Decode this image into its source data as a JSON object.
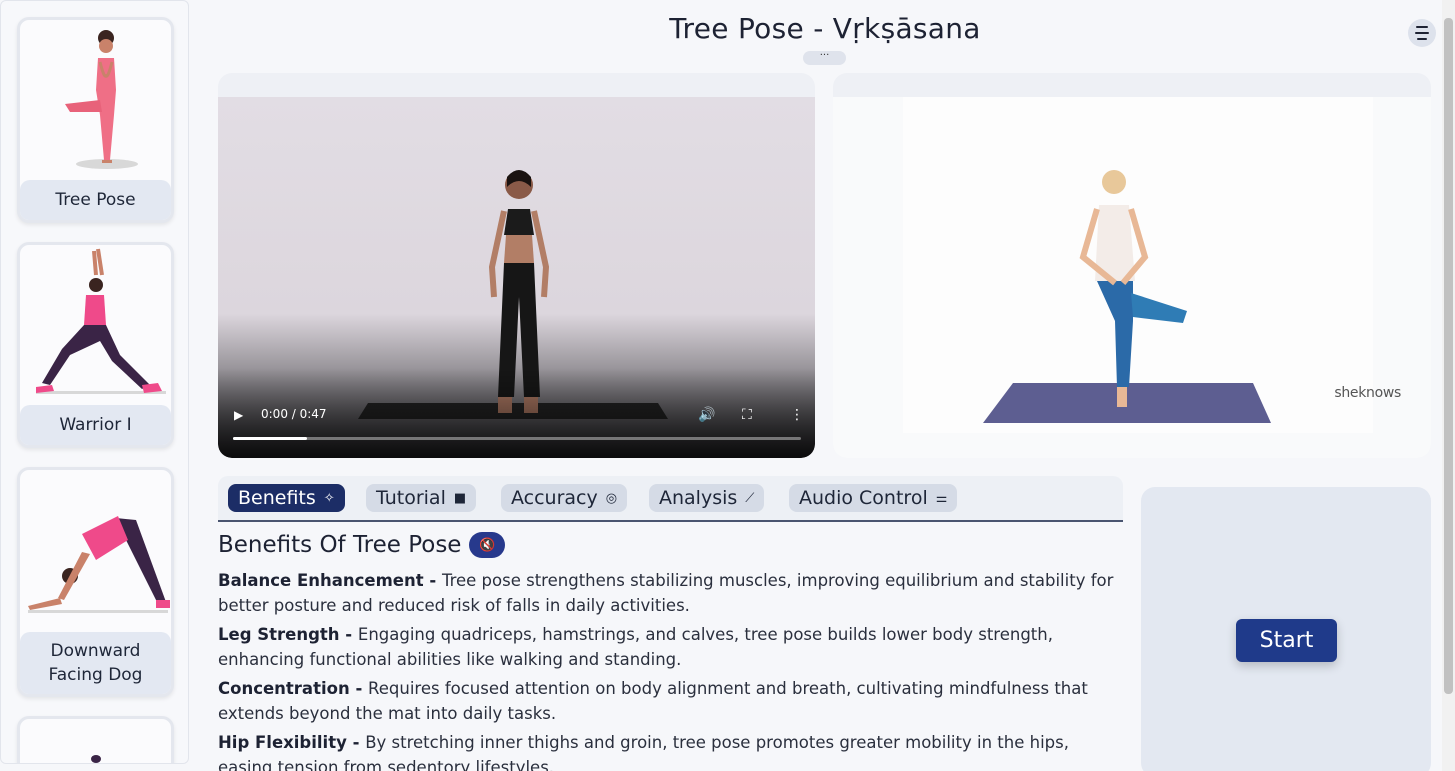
{
  "sidebar": {
    "poses": [
      {
        "label": "Tree Pose"
      },
      {
        "label": "Warrior I"
      },
      {
        "label": "Downward Facing Dog"
      },
      {
        "label": ""
      }
    ]
  },
  "header": {
    "title": "Tree Pose - Vṛkṣāsana",
    "more": "···"
  },
  "video": {
    "time": "0:00 / 0:47",
    "progress_fraction": 0.13
  },
  "reference": {
    "watermark": "sheknows"
  },
  "tabs": [
    {
      "label": "Benefits",
      "icon": "sparkle-icon",
      "glyph": "✧",
      "active": true
    },
    {
      "label": "Tutorial",
      "icon": "video-camera-icon",
      "glyph": "■",
      "active": false
    },
    {
      "label": "Accuracy",
      "icon": "target-icon",
      "glyph": "◎",
      "active": false
    },
    {
      "label": "Analysis",
      "icon": "line-chart-icon",
      "glyph": "⟋",
      "active": false
    },
    {
      "label": "Audio Control",
      "icon": "sliders-icon",
      "glyph": "⚌",
      "active": false
    }
  ],
  "benefits": {
    "title": "Benefits Of Tree Pose",
    "items": [
      {
        "name": "Balance Enhancement - ",
        "text": "Tree pose strengthens stabilizing muscles, improving equilibrium and stability for better posture and reduced risk of falls in daily activities."
      },
      {
        "name": "Leg Strength - ",
        "text": "Engaging quadriceps, hamstrings, and calves, tree pose builds lower body strength, enhancing functional abilities like walking and standing."
      },
      {
        "name": "Concentration - ",
        "text": "Requires focused attention on body alignment and breath, cultivating mindfulness that extends beyond the mat into daily tasks."
      },
      {
        "name": "Hip Flexibility - ",
        "text": "By stretching inner thighs and groin, tree pose promotes greater mobility in the hips, easing tension from sedentory lifestyles."
      }
    ]
  },
  "start": {
    "label": "Start"
  },
  "colors": {
    "accent": "#1c2d66",
    "button": "#1f3a8a",
    "pink": "#ef6f86"
  }
}
